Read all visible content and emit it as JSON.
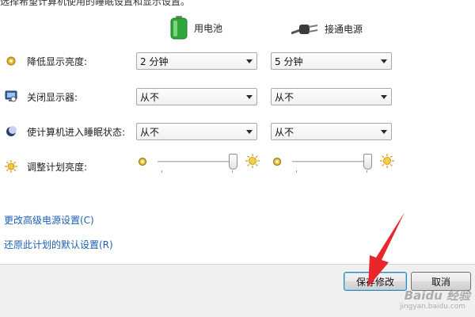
{
  "top_text": "选择希望计算机使用的睡眠设置和显示设置。",
  "columns": {
    "battery": {
      "label": "用电池",
      "icon": "battery-icon"
    },
    "plugged": {
      "label": "接通电源",
      "icon": "power-plug-icon"
    }
  },
  "rows": [
    {
      "label": "降低显示亮度:",
      "icon": "dim-display-icon",
      "battery": "2 分钟",
      "plugged": "5 分钟"
    },
    {
      "label": "关闭显示器:",
      "icon": "monitor-icon",
      "battery": "从不",
      "plugged": "从不"
    },
    {
      "label": "使计算机进入睡眠状态:",
      "icon": "sleep-moon-icon",
      "battery": "从不",
      "plugged": "从不"
    }
  ],
  "brightness": {
    "label": "调整计划亮度:",
    "icon": "brightness-sun-icon",
    "battery_level": 0.95,
    "plugged_level": 0.95
  },
  "links": {
    "advanced": "更改高级电源设置(C)",
    "restore": "还原此计划的默认设置(R)"
  },
  "buttons": {
    "save": "保存修改",
    "cancel": "取消"
  },
  "annotation": {
    "arrow_color": "#e8262b"
  },
  "watermark": {
    "text": "Baidu 经验",
    "url": "jingyan.baidu.com"
  }
}
